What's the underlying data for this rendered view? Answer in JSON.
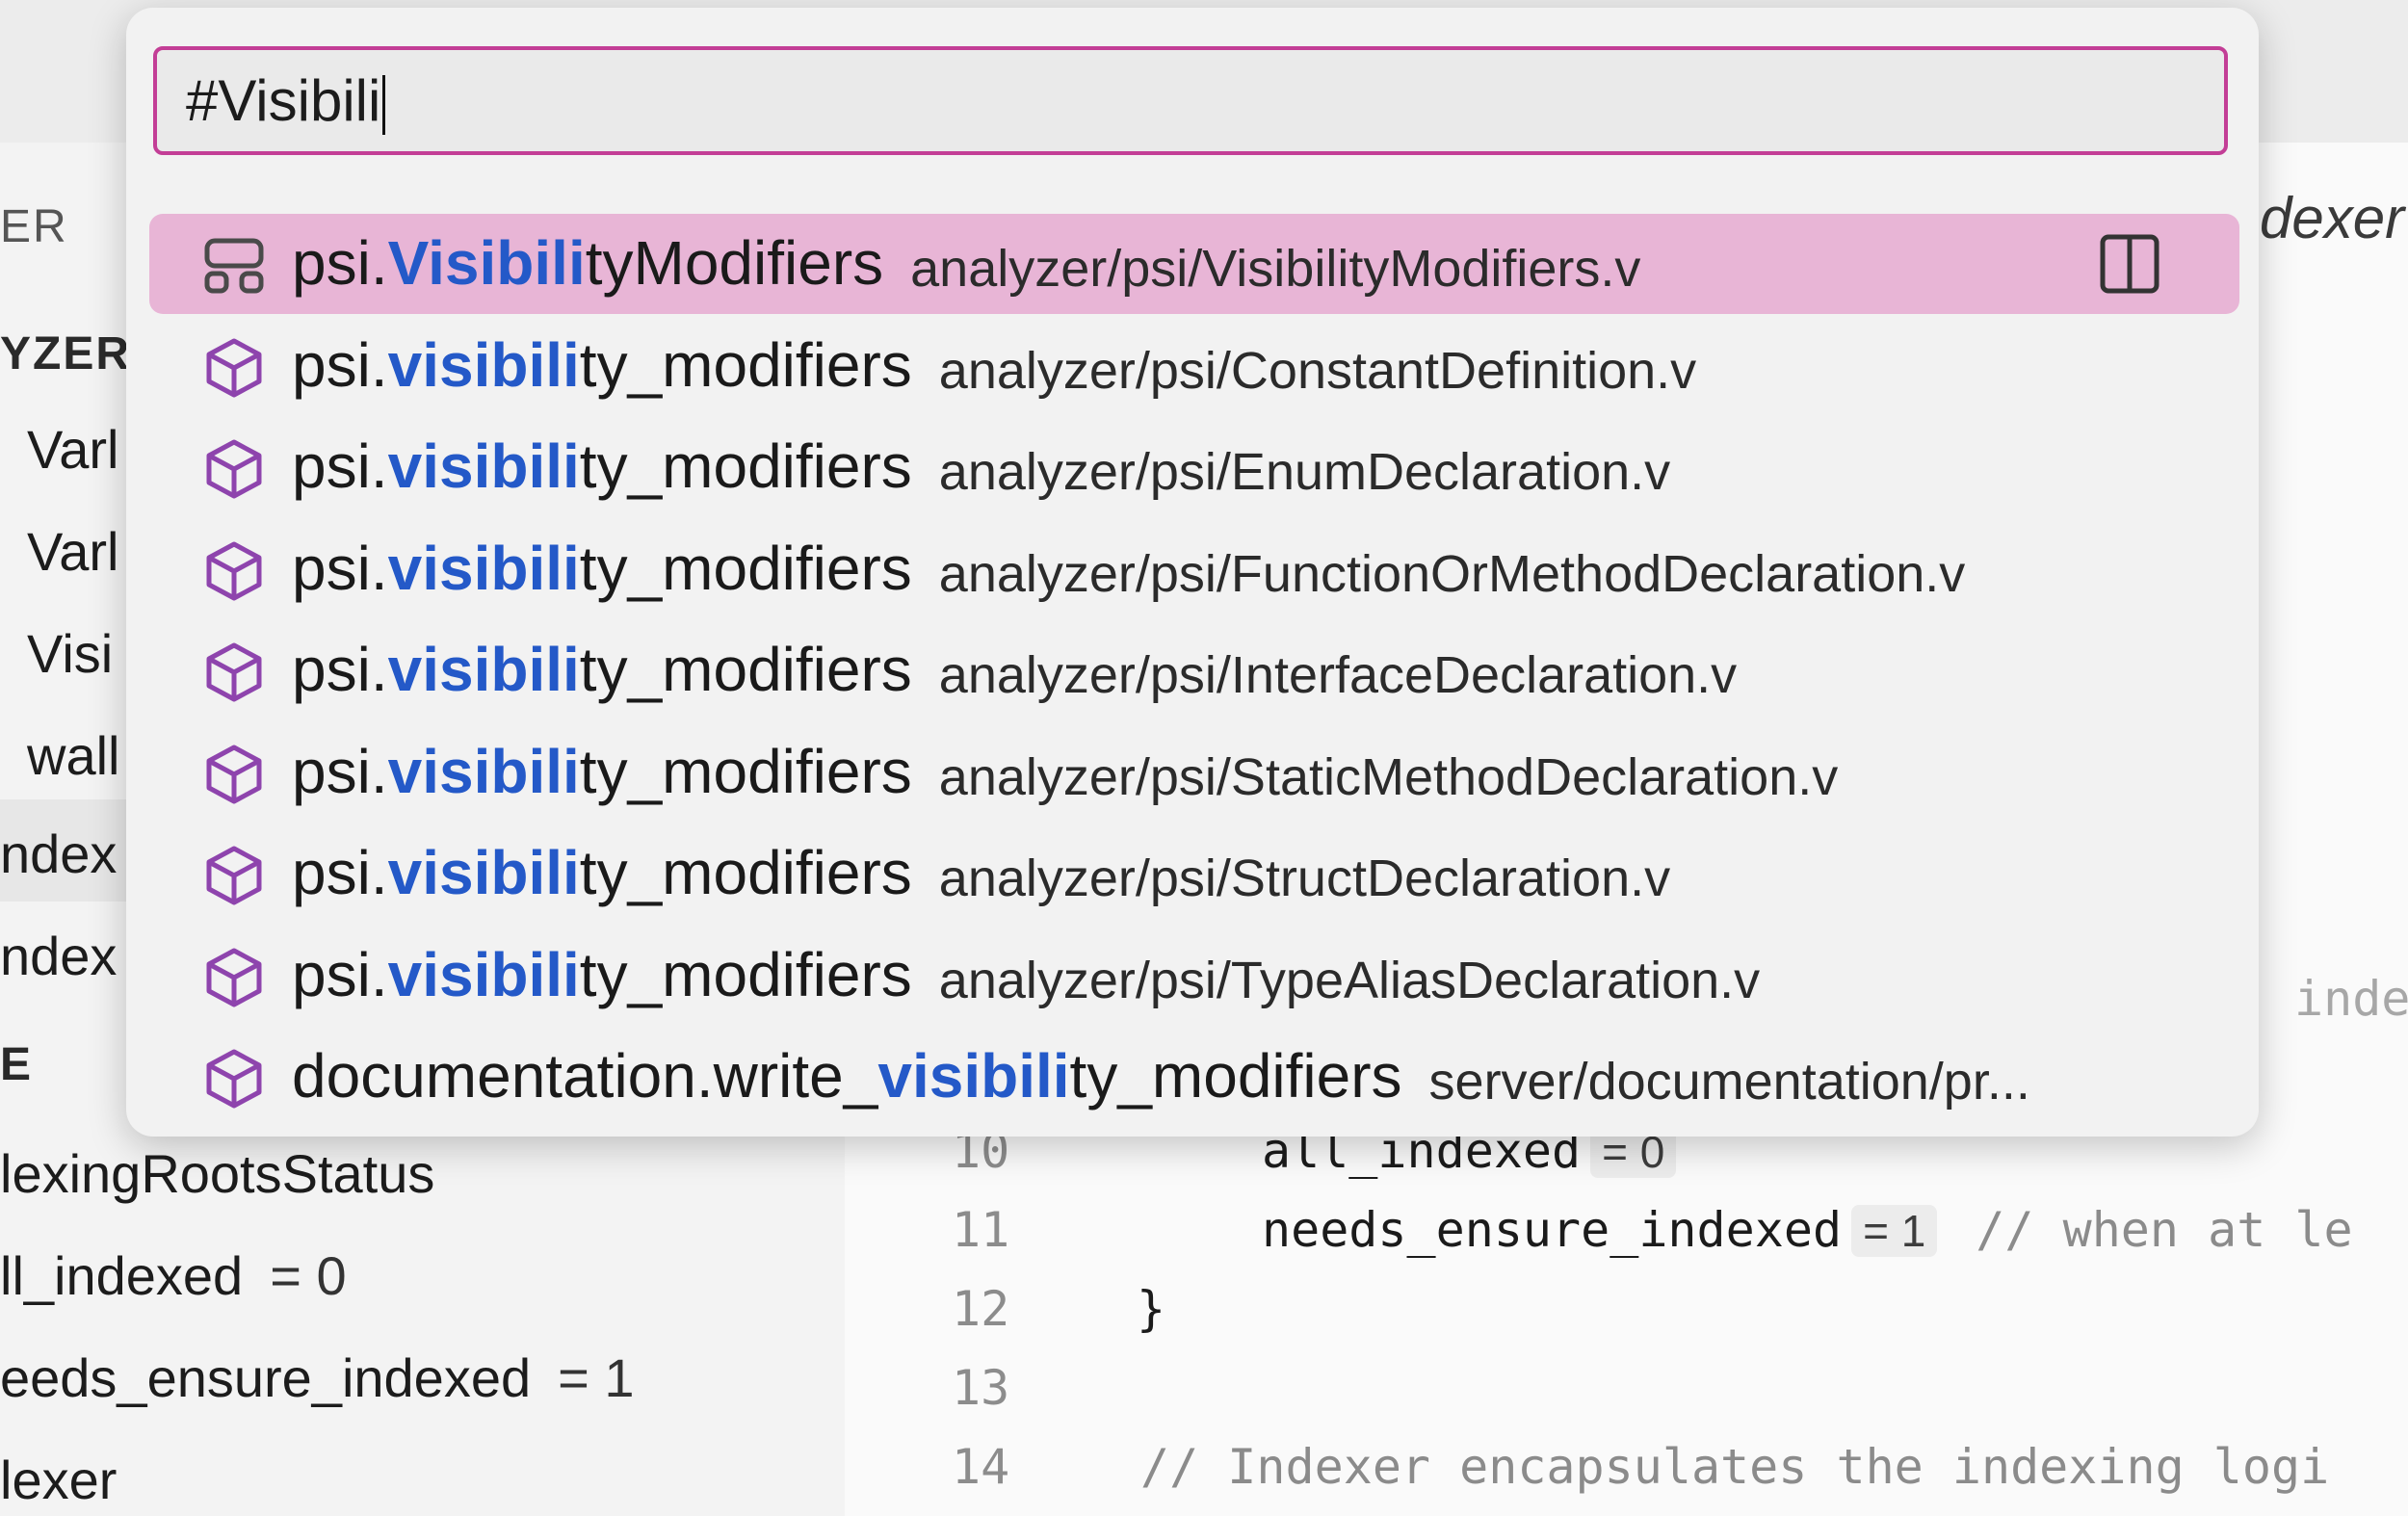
{
  "search": {
    "value": "#Visibili"
  },
  "results": [
    {
      "icon": "struct-icon",
      "pre": "psi.",
      "match": "Visibili",
      "post": "tyModifiers",
      "path": "analyzer/psi/VisibilityModifiers.v",
      "selected": true,
      "action_icon": "split-view-icon"
    },
    {
      "icon": "field-icon",
      "pre": "psi.",
      "match": "visibili",
      "post": "ty_modifiers",
      "path": "analyzer/psi/ConstantDefinition.v"
    },
    {
      "icon": "field-icon",
      "pre": "psi.",
      "match": "visibili",
      "post": "ty_modifiers",
      "path": "analyzer/psi/EnumDeclaration.v"
    },
    {
      "icon": "field-icon",
      "pre": "psi.",
      "match": "visibili",
      "post": "ty_modifiers",
      "path": "analyzer/psi/FunctionOrMethodDeclaration.v"
    },
    {
      "icon": "field-icon",
      "pre": "psi.",
      "match": "visibili",
      "post": "ty_modifiers",
      "path": "analyzer/psi/InterfaceDeclaration.v"
    },
    {
      "icon": "field-icon",
      "pre": "psi.",
      "match": "visibili",
      "post": "ty_modifiers",
      "path": "analyzer/psi/StaticMethodDeclaration.v"
    },
    {
      "icon": "field-icon",
      "pre": "psi.",
      "match": "visibili",
      "post": "ty_modifiers",
      "path": "analyzer/psi/StructDeclaration.v"
    },
    {
      "icon": "field-icon",
      "pre": "psi.",
      "match": "visibili",
      "post": "ty_modifiers",
      "path": "analyzer/psi/TypeAliasDeclaration.v"
    },
    {
      "icon": "field-icon",
      "pre": "documentation.write_",
      "match": "visibili",
      "post": "ty_modifiers",
      "path": "server/documentation/pr..."
    }
  ],
  "sidebar": {
    "header_top": "ER",
    "header_analyzer": "YZER",
    "items": [
      "Varl",
      "Varl",
      "Visi",
      "wall"
    ],
    "index_items": [
      "ndex",
      "ndex"
    ],
    "header_e": "E",
    "struct_name": "lexingRootsStatus",
    "fields": [
      {
        "name": "ll_indexed",
        "value": "= 0"
      },
      {
        "name": "eeds_ensure_indexed",
        "value": "= 1"
      }
    ],
    "last": "lexer"
  },
  "editor": {
    "tab_title": "dexer",
    "faded_text": "inde",
    "lines": [
      {
        "no": "10",
        "code": "all_indexed",
        "hint": "= 0",
        "comment": ""
      },
      {
        "no": "11",
        "code": "needs_ensure_indexed",
        "hint": "= 1",
        "comment": "// when at le"
      },
      {
        "no": "12",
        "code": "}",
        "hint": "",
        "comment": ""
      },
      {
        "no": "13",
        "code": "",
        "hint": "",
        "comment": ""
      },
      {
        "no": "14",
        "code": "",
        "hint": "",
        "comment": "// Indexer encapsulates the indexing logi"
      }
    ]
  }
}
